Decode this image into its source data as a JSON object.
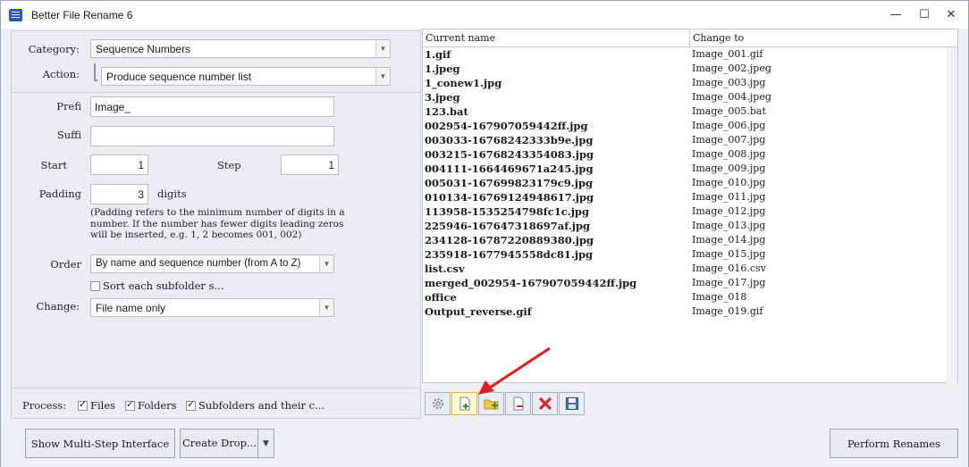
{
  "window": {
    "title": "Better File Rename 6",
    "minimize_glyph": "—",
    "maximize_glyph": "☐",
    "close_glyph": "✕"
  },
  "left_panel": {
    "category_label": "Category:",
    "category_value": "Sequence Numbers",
    "action_label": "Action:",
    "action_value": "Produce sequence number list",
    "prefix_label": "Prefi",
    "prefix_value": "Image_",
    "suffix_label": "Suffi",
    "suffix_value": "",
    "start_label": "Start",
    "start_value": "1",
    "step_label": "Step",
    "step_value": "1",
    "padding_label": "Padding",
    "padding_value": "3",
    "digits_label": "digits",
    "padding_note": "(Padding refers to the minimum number of digits in a number. If the number has fewer digits leading zeros will be inserted, e.g. 1, 2 becomes 001, 002)",
    "order_label": "Order",
    "order_value": "By name and sequence number (from A to Z)",
    "sort_subfolder_label": "Sort each subfolder s...",
    "change_label": "Change:",
    "change_value": "File name only",
    "process_label": "Process:",
    "files_label": "Files",
    "folders_label": "Folders",
    "subfolders_label": "Subfolders and their c..."
  },
  "file_list": {
    "columns": [
      "Current name",
      "Change to"
    ],
    "rows": [
      {
        "current": "1.gif",
        "change": "Image_001.gif"
      },
      {
        "current": "1.jpeg",
        "change": "Image_002.jpeg"
      },
      {
        "current": "1_conew1.jpg",
        "change": "Image_003.jpg"
      },
      {
        "current": "3.jpeg",
        "change": "Image_004.jpeg"
      },
      {
        "current": "123.bat",
        "change": "Image_005.bat"
      },
      {
        "current": "002954-167907059442ff.jpg",
        "change": "Image_006.jpg"
      },
      {
        "current": "003033-16768242333b9e.jpg",
        "change": "Image_007.jpg"
      },
      {
        "current": "003215-16768243354083.jpg",
        "change": "Image_008.jpg"
      },
      {
        "current": "004111-1664469671a245.jpg",
        "change": "Image_009.jpg"
      },
      {
        "current": "005031-167699823179c9.jpg",
        "change": "Image_010.jpg"
      },
      {
        "current": "010134-16769124948617.jpg",
        "change": "Image_011.jpg"
      },
      {
        "current": "113958-1535254798fc1c.jpg",
        "change": "Image_012.jpg"
      },
      {
        "current": "225946-167647318697af.jpg",
        "change": "Image_013.jpg"
      },
      {
        "current": "234128-16787220889380.jpg",
        "change": "Image_014.jpg"
      },
      {
        "current": "235918-1677945558dc81.jpg",
        "change": "Image_015.jpg"
      },
      {
        "current": "list.csv",
        "change": "Image_016.csv"
      },
      {
        "current": "merged_002954-167907059442ff.jpg",
        "change": "Image_017.jpg"
      },
      {
        "current": "office",
        "change": "Image_018"
      },
      {
        "current": "Output_reverse.gif",
        "change": "Image_019.gif"
      }
    ]
  },
  "toolbar": {
    "icons": [
      "gear-icon",
      "add-files-icon",
      "add-folder-icon",
      "remove-file-icon",
      "clear-icon",
      "save-icon"
    ]
  },
  "bottom": {
    "multi_step_label": "Show Multi-Step Interface",
    "create_drop_label": "Create Drop...",
    "perform_label": "Perform Renames"
  },
  "colors": {
    "accent": "#2d5aa8",
    "arrow_red": "#e02020",
    "clear_red": "#d42b2b"
  }
}
